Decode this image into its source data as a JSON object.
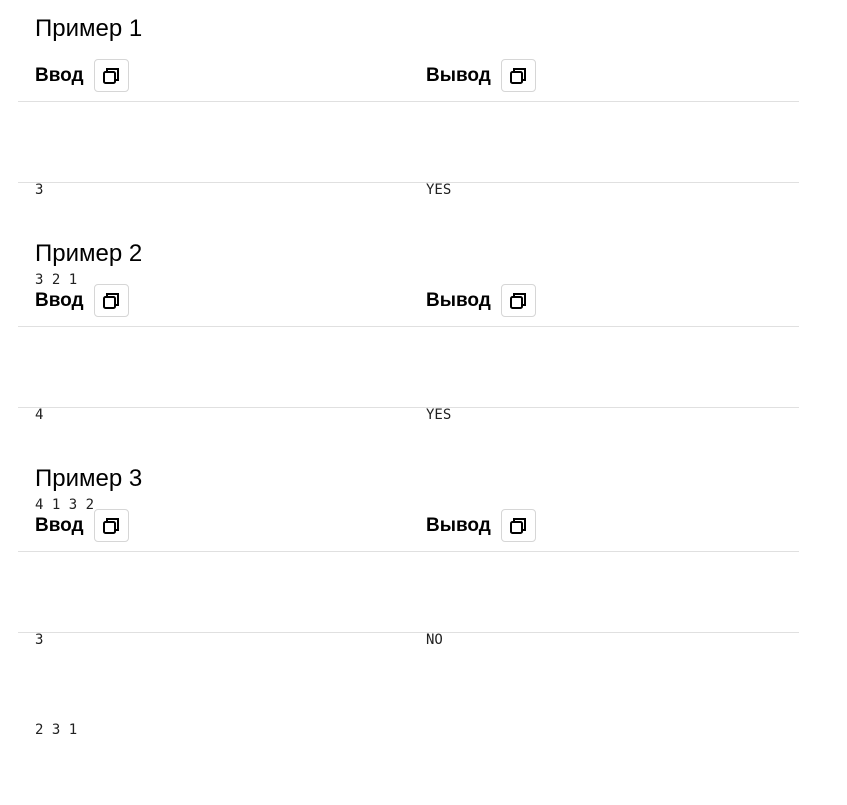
{
  "examples": [
    {
      "title": "Пример 1",
      "input_label": "Ввод",
      "output_label": "Вывод",
      "input_lines": [
        "3",
        "3 2 1"
      ],
      "output_lines": [
        "YES"
      ]
    },
    {
      "title": "Пример 2",
      "input_label": "Ввод",
      "output_label": "Вывод",
      "input_lines": [
        "4",
        "4 1 3 2"
      ],
      "output_lines": [
        "YES"
      ]
    },
    {
      "title": "Пример 3",
      "input_label": "Ввод",
      "output_label": "Вывод",
      "input_lines": [
        "3",
        "2 3 1"
      ],
      "output_lines": [
        "NO"
      ]
    }
  ],
  "icons": {
    "copy": "copy-icon"
  },
  "colors": {
    "divider": "#e0e0e0",
    "button_border": "#d6d6d6",
    "text": "#000000",
    "mono_text": "#222222"
  }
}
